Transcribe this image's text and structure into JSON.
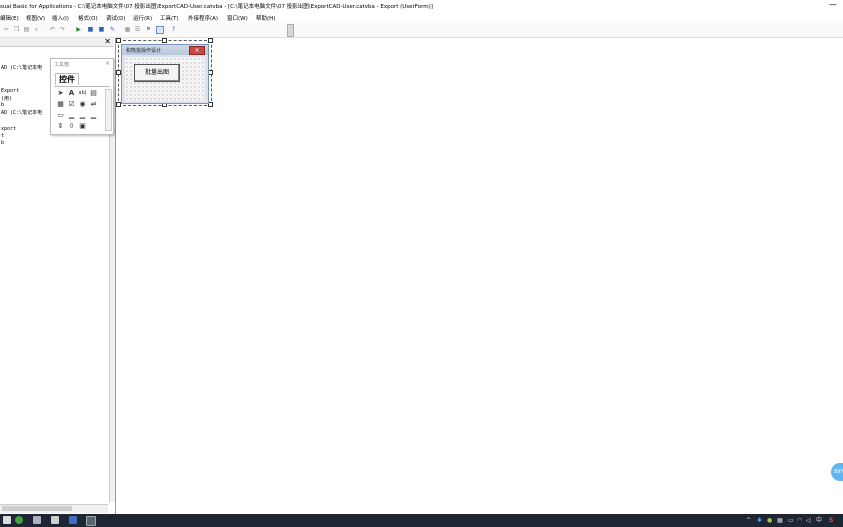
{
  "window": {
    "title": "sual Basic for Applications - C:\\笔记本电脑文件\\07 投影出图\\ExportCAD-User.catvba - [C:\\笔记本电脑文件\\07 投影出图\\ExportCAD-User.catvba - Export (UserForm)]",
    "minimize": "—"
  },
  "menu": [
    "编辑(E)",
    "视图(V)",
    "插入(I)",
    "格式(O)",
    "调试(D)",
    "运行(R)",
    "工具(T)",
    "外接程序(A)",
    "窗口(W)",
    "帮助(H)"
  ],
  "toolbar": {
    "close_glyph": "✕"
  },
  "code_pane": {
    "close": "✕",
    "lines": [
      "AD (C:\\笔记本电",
      "Export",
      "(用)",
      "b",
      "AD (C:\\笔记本电",
      "xport",
      "t",
      "b"
    ]
  },
  "toolbox": {
    "title": "工具箱",
    "tab": "控件",
    "controls": [
      "arrow-pointer",
      "label",
      "textbox",
      "combobox",
      "listbox",
      "checkbox",
      "optionbutton",
      "togglebutton",
      "frame",
      "commandbutton",
      "tabstrip",
      "multipage",
      "scrollbar",
      "spinbutton",
      "image"
    ]
  },
  "userform": {
    "caption": "和熊批操作设计",
    "button_label": "批量出图",
    "close": "✕"
  },
  "tray": {
    "lang": "中",
    "sogou": "S",
    "assist": "89%"
  },
  "colors": {
    "form_bg": "#dde3ea",
    "taskbar": "#1f2633",
    "close_red": "#c9493e"
  }
}
